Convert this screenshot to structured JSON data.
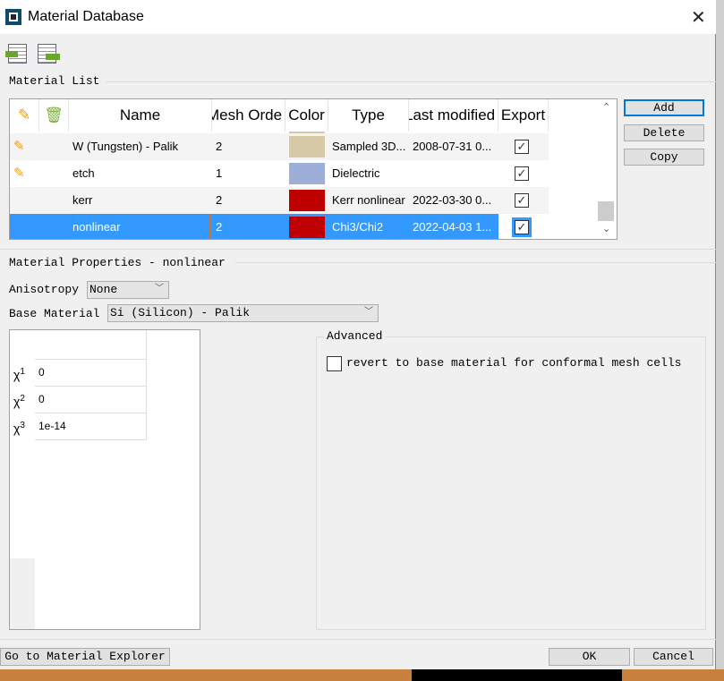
{
  "window": {
    "title": "Material Database",
    "close_icon": "close-icon"
  },
  "toolbar": {
    "import_icon": "import-table-icon",
    "export_icon": "export-table-icon"
  },
  "material_list": {
    "label": "Material List",
    "columns": {
      "edit": "pencil-icon",
      "delete": "trash-icon",
      "name": "Name",
      "mesh_order": "Mesh Orde",
      "color": "Color",
      "type": "Type",
      "last_modified": "Last modified",
      "export": "Export"
    },
    "rows": [
      {
        "name": "W (Tungsten) - Palik",
        "mesh_order": "2",
        "color": "#d6c9a6",
        "type": "Sampled 3D...",
        "last_modified": "2008-07-31 0...",
        "export": true,
        "editable_icon": true
      },
      {
        "name": "etch",
        "mesh_order": "1",
        "color": "#9daed9",
        "type": "Dielectric",
        "last_modified": "",
        "export": true,
        "editable_icon": true
      },
      {
        "name": "kerr",
        "mesh_order": "2",
        "color": "#c00000",
        "type": "Kerr nonlinear",
        "last_modified": "2022-03-30 0...",
        "export": true,
        "editable_icon": false
      },
      {
        "name": "nonlinear",
        "mesh_order": "2",
        "color": "#c00000",
        "type": "Chi3/Chi2",
        "last_modified": "2022-04-03 1...",
        "export": true,
        "editable_icon": false,
        "selected": true
      }
    ],
    "buttons": {
      "add": "Add",
      "delete": "Delete",
      "copy": "Copy"
    }
  },
  "properties": {
    "label": "Material Properties - nonlinear",
    "anisotropy_label": "Anisotropy",
    "anisotropy_value": "None",
    "base_material_label": "Base Material",
    "base_material_value": "Si (Silicon) - Palik",
    "chi": [
      {
        "label": "χ",
        "sup": "1",
        "value": "0"
      },
      {
        "label": "χ",
        "sup": "2",
        "value": "0"
      },
      {
        "label": "χ",
        "sup": "3",
        "value": "1e-14"
      }
    ],
    "advanced_label": "Advanced",
    "revert_label": "revert to base material for conformal mesh cells",
    "revert_checked": false
  },
  "footer": {
    "explorer": "Go to Material Explorer",
    "ok": "OK",
    "cancel": "Cancel"
  },
  "colors": {
    "selection": "#3399ff",
    "accent": "#0078d7"
  }
}
